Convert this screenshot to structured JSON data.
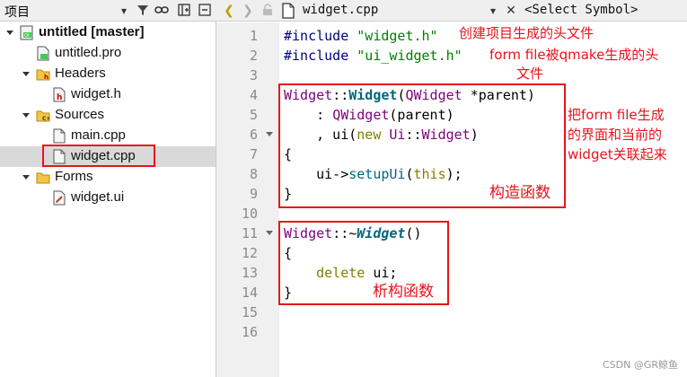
{
  "project_pane": {
    "title": "项目",
    "tree": [
      {
        "label": "untitled [master]",
        "bold": true,
        "expanded": true,
        "icon": "qt-project-icon"
      },
      {
        "label": "untitled.pro",
        "icon": "pro-file-icon"
      },
      {
        "label": "Headers",
        "expanded": true,
        "icon": "headers-folder-icon"
      },
      {
        "label": "widget.h",
        "icon": "header-file-icon"
      },
      {
        "label": "Sources",
        "expanded": true,
        "icon": "sources-folder-icon"
      },
      {
        "label": "main.cpp",
        "icon": "cpp-file-icon"
      },
      {
        "label": "widget.cpp",
        "icon": "cpp-file-icon",
        "selected": true
      },
      {
        "label": "Forms",
        "expanded": true,
        "icon": "forms-folder-icon"
      },
      {
        "label": "widget.ui",
        "icon": "ui-file-icon"
      }
    ]
  },
  "editor": {
    "file_name": "widget.cpp",
    "symbol_placeholder": "<Select Symbol>",
    "line_numbers": [
      "1",
      "2",
      "3",
      "4",
      "5",
      "6",
      "7",
      "8",
      "9",
      "10",
      "11",
      "12",
      "13",
      "14",
      "15",
      "16"
    ],
    "code": {
      "l1": {
        "pp": "#include",
        "str": "\"widget.h\""
      },
      "l2": {
        "pp": "#include",
        "str": "\"ui_widget.h\""
      },
      "l4": {
        "cls": "Widget",
        "sep": "::",
        "fn": "Widget",
        "open": "(",
        "type": "QWidget",
        "rest": " *parent)"
      },
      "l5": {
        "indent": "    : ",
        "fn": "QWidget",
        "rest": "(parent)"
      },
      "l6": {
        "indent": "    , ui(",
        "kw": "new",
        "sp": " ",
        "ns": "Ui",
        "sep": "::",
        "type": "Widget",
        "rest": ")"
      },
      "l7": "{",
      "l8": {
        "indent": "    ui->",
        "fn": "setupUi",
        "open": "(",
        "kw": "this",
        "rest": ");"
      },
      "l9": "}",
      "l11": {
        "cls": "Widget",
        "sep": "::~",
        "fn": "Widget",
        "rest": "()"
      },
      "l12": "{",
      "l13": {
        "indent": "    ",
        "kw": "delete",
        "rest": " ui;"
      },
      "l14": "}"
    }
  },
  "annotations": {
    "header_note": "创建项目生成的头文件",
    "form_note_1": "form file被qmake生成的头",
    "form_note_2": "文件",
    "link_note_1": "把form file生成",
    "link_note_2": "的界面和当前的",
    "link_note_3": "widget关联起来",
    "ctor_note": "构造函数",
    "dtor_note": "析构函数",
    "color": "#e8131c"
  },
  "watermark": "CSDN @GR鲸鱼"
}
